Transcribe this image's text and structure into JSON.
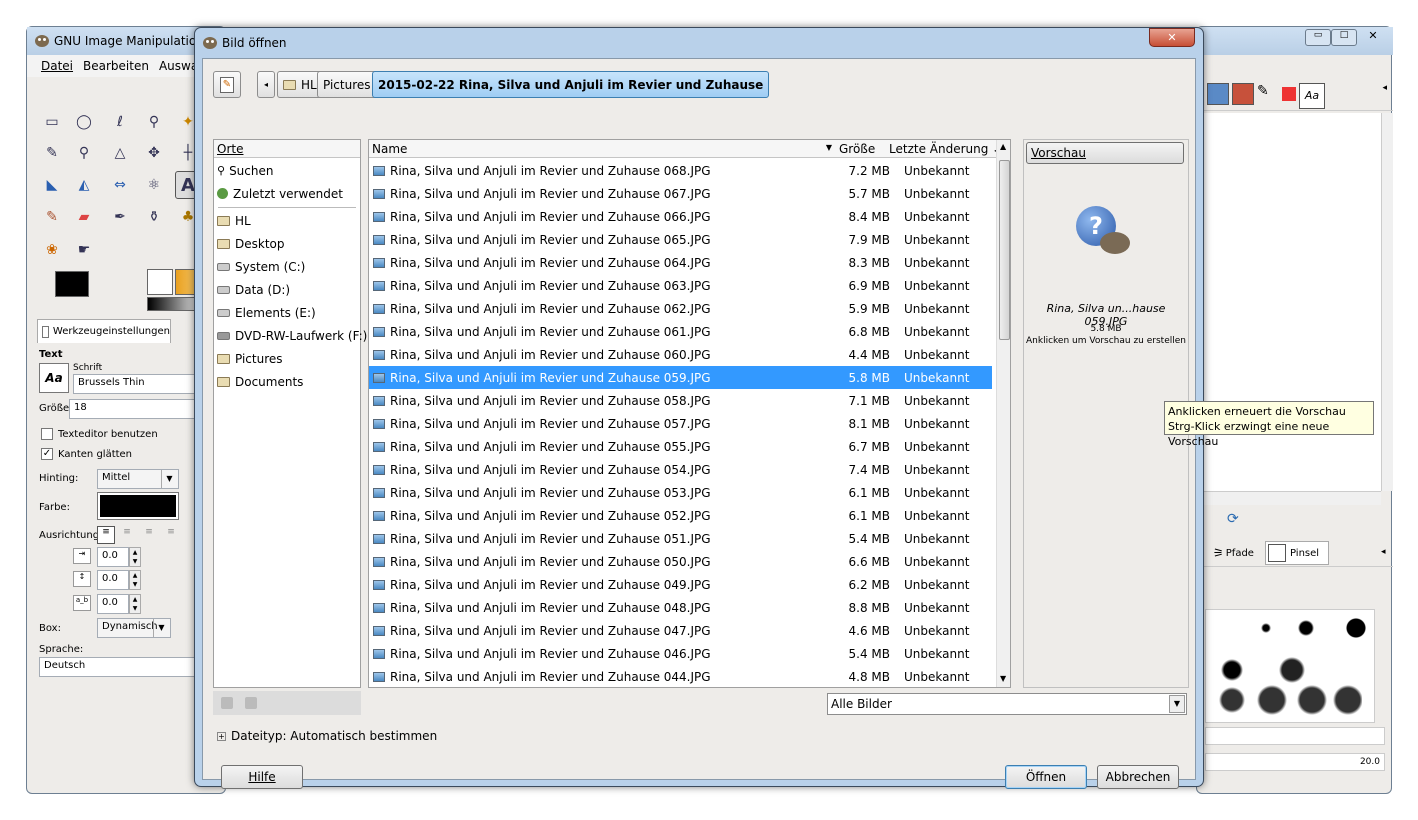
{
  "gimp": {
    "title": "GNU Image Manipulation",
    "menu": [
      "Datei",
      "Bearbeiten",
      "Auswah"
    ],
    "tool_options_tab": "Werkzeugeinstellungen",
    "text_heading": "Text",
    "font_label": "Schrift",
    "font_value": "Brussels Thin",
    "size_label": "Größe:",
    "size_value": "18",
    "use_editor": "Texteditor benutzen",
    "antialias": "Kanten glätten",
    "hinting_label": "Hinting:",
    "hinting_value": "Mittel",
    "color_label": "Farbe:",
    "justify_label": "Ausrichtung:",
    "indent_value": "0.0",
    "line_spacing_value": "0.0",
    "letter_spacing_value": "0.0",
    "box_label": "Box:",
    "box_value": "Dynamisch",
    "language_label": "Sprache:",
    "language_value": "Deutsch"
  },
  "right_panel": {
    "tabs": [
      "Pfade",
      "Pinsel"
    ],
    "brush_size": "20.0"
  },
  "dialog": {
    "title": "Bild öffnen",
    "path": [
      "HL",
      "Pictures",
      "2015-02-22 Rina, Silva und Anjuli im Revier und Zuhause"
    ],
    "places_header": "Orte",
    "places": [
      {
        "label": "Suchen",
        "icon": "search-icon"
      },
      {
        "label": "Zuletzt verwendet",
        "icon": "recent-icon"
      },
      {
        "label": "HL",
        "icon": "folder-icon"
      },
      {
        "label": "Desktop",
        "icon": "folder-icon"
      },
      {
        "label": "System (C:)",
        "icon": "drive-icon"
      },
      {
        "label": "Data (D:)",
        "icon": "drive-icon"
      },
      {
        "label": "Elements (E:)",
        "icon": "drive-icon"
      },
      {
        "label": "DVD-RW-Laufwerk (F:)",
        "icon": "dvd-icon"
      },
      {
        "label": "Pictures",
        "icon": "folder-icon"
      },
      {
        "label": "Documents",
        "icon": "folder-icon"
      }
    ],
    "columns": {
      "name": "Name",
      "size": "Größe",
      "modified": "Letzte Änderung"
    },
    "files": [
      {
        "name": "Rina, Silva und Anjuli im Revier und Zuhause 068.JPG",
        "size": "7.2 MB",
        "modified": "Unbekannt"
      },
      {
        "name": "Rina, Silva und Anjuli im Revier und Zuhause 067.JPG",
        "size": "5.7 MB",
        "modified": "Unbekannt"
      },
      {
        "name": "Rina, Silva und Anjuli im Revier und Zuhause 066.JPG",
        "size": "8.4 MB",
        "modified": "Unbekannt"
      },
      {
        "name": "Rina, Silva und Anjuli im Revier und Zuhause 065.JPG",
        "size": "7.9 MB",
        "modified": "Unbekannt"
      },
      {
        "name": "Rina, Silva und Anjuli im Revier und Zuhause 064.JPG",
        "size": "8.3 MB",
        "modified": "Unbekannt"
      },
      {
        "name": "Rina, Silva und Anjuli im Revier und Zuhause 063.JPG",
        "size": "6.9 MB",
        "modified": "Unbekannt"
      },
      {
        "name": "Rina, Silva und Anjuli im Revier und Zuhause 062.JPG",
        "size": "5.9 MB",
        "modified": "Unbekannt"
      },
      {
        "name": "Rina, Silva und Anjuli im Revier und Zuhause 061.JPG",
        "size": "6.8 MB",
        "modified": "Unbekannt"
      },
      {
        "name": "Rina, Silva und Anjuli im Revier und Zuhause 060.JPG",
        "size": "4.4 MB",
        "modified": "Unbekannt"
      },
      {
        "name": "Rina, Silva und Anjuli im Revier und Zuhause 059.JPG",
        "size": "5.8 MB",
        "modified": "Unbekannt",
        "selected": true
      },
      {
        "name": "Rina, Silva und Anjuli im Revier und Zuhause 058.JPG",
        "size": "7.1 MB",
        "modified": "Unbekannt"
      },
      {
        "name": "Rina, Silva und Anjuli im Revier und Zuhause 057.JPG",
        "size": "8.1 MB",
        "modified": "Unbekannt"
      },
      {
        "name": "Rina, Silva und Anjuli im Revier und Zuhause 055.JPG",
        "size": "6.7 MB",
        "modified": "Unbekannt"
      },
      {
        "name": "Rina, Silva und Anjuli im Revier und Zuhause 054.JPG",
        "size": "7.4 MB",
        "modified": "Unbekannt"
      },
      {
        "name": "Rina, Silva und Anjuli im Revier und Zuhause 053.JPG",
        "size": "6.1 MB",
        "modified": "Unbekannt"
      },
      {
        "name": "Rina, Silva und Anjuli im Revier und Zuhause 052.JPG",
        "size": "6.1 MB",
        "modified": "Unbekannt"
      },
      {
        "name": "Rina, Silva und Anjuli im Revier und Zuhause 051.JPG",
        "size": "5.4 MB",
        "modified": "Unbekannt"
      },
      {
        "name": "Rina, Silva und Anjuli im Revier und Zuhause 050.JPG",
        "size": "6.6 MB",
        "modified": "Unbekannt"
      },
      {
        "name": "Rina, Silva und Anjuli im Revier und Zuhause 049.JPG",
        "size": "6.2 MB",
        "modified": "Unbekannt"
      },
      {
        "name": "Rina, Silva und Anjuli im Revier und Zuhause 048.JPG",
        "size": "8.8 MB",
        "modified": "Unbekannt"
      },
      {
        "name": "Rina, Silva und Anjuli im Revier und Zuhause 047.JPG",
        "size": "4.6 MB",
        "modified": "Unbekannt"
      },
      {
        "name": "Rina, Silva und Anjuli im Revier und Zuhause 046.JPG",
        "size": "5.4 MB",
        "modified": "Unbekannt"
      },
      {
        "name": "Rina, Silva und Anjuli im Revier und Zuhause 044.JPG",
        "size": "4.8 MB",
        "modified": "Unbekannt"
      }
    ],
    "preview": {
      "button": "Vorschau",
      "filename": "Rina, Silva un...hause 059.JPG",
      "size": "5.8 MB",
      "hint": "Anklicken um Vorschau zu erstellen"
    },
    "filter": "Alle Bilder",
    "filetype": "Dateityp: Automatisch bestimmen",
    "buttons": {
      "help": "Hilfe",
      "open": "Öffnen",
      "cancel": "Abbrechen"
    }
  },
  "tooltip": {
    "line1": "Anklicken erneuert die Vorschau",
    "line2": "Strg-Klick erzwingt eine neue Vorschau"
  }
}
